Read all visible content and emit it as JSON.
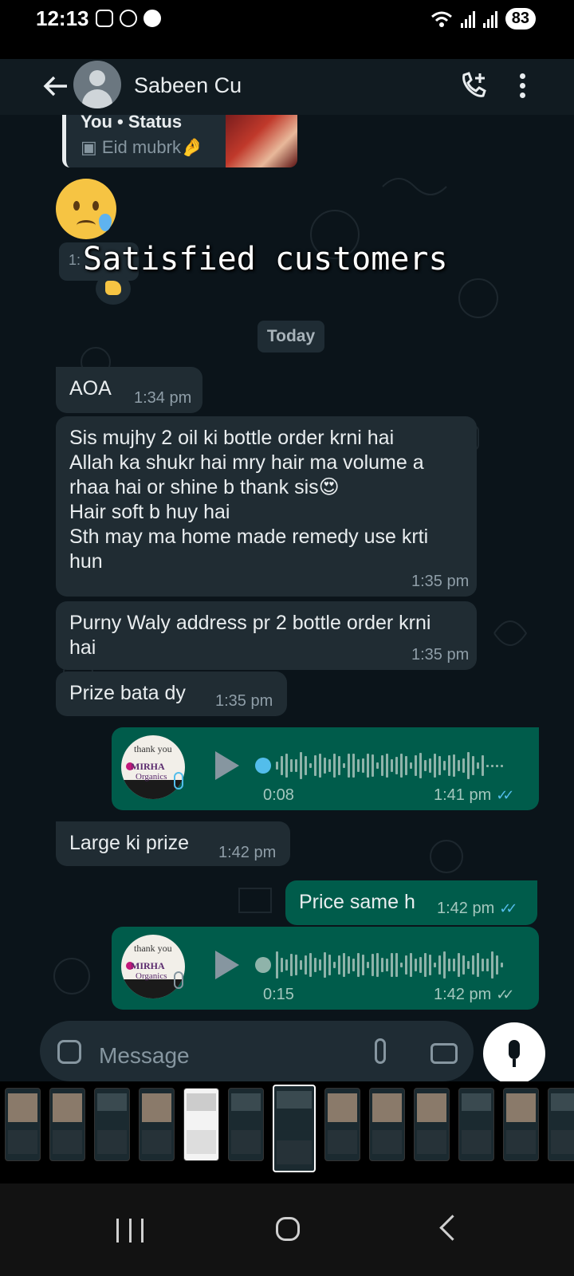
{
  "status_bar": {
    "time": "12:13",
    "battery": "83"
  },
  "header": {
    "contact_name": "Sabeen Cu"
  },
  "quoted_status": {
    "sender": "You • Status",
    "caption": "Eid mubrk🤌"
  },
  "reaction": {
    "time_partial": "1:"
  },
  "overlay": {
    "text": "Satisfied customers"
  },
  "date_divider": "Today",
  "messages": [
    {
      "text": "AOA",
      "time": "1:34 pm"
    },
    {
      "text": "Sis mujhy 2 oil ki bottle order krni hai\nAllah ka shukr hai mry hair ma volume a\nrhaa hai or shine b thank sis😍\nHair soft b huy hai\nSth may ma home made remedy use krti\nhun",
      "time": "1:35 pm"
    },
    {
      "text": "Purny Waly address pr 2 bottle order krni\nhai",
      "time": "1:35 pm"
    },
    {
      "text": "Prize bata dy",
      "time": "1:35 pm"
    },
    {
      "duration": "0:08",
      "time": "1:41 pm",
      "progress": 0.0
    },
    {
      "text": "Large ki prize",
      "time": "1:42 pm"
    },
    {
      "text": "Price same h",
      "time": "1:42 pm"
    },
    {
      "duration": "0:15",
      "time": "1:42 pm",
      "progress": 0.0
    }
  ],
  "voice_avatar": {
    "line1": "thank you",
    "line2": "MIRHA",
    "line3": "Organics"
  },
  "composer": {
    "placeholder": "Message"
  },
  "colors": {
    "incoming": "#202c33",
    "outgoing": "#005c4b",
    "read_ticks": "#53bdeb",
    "background": "#0b141a"
  }
}
